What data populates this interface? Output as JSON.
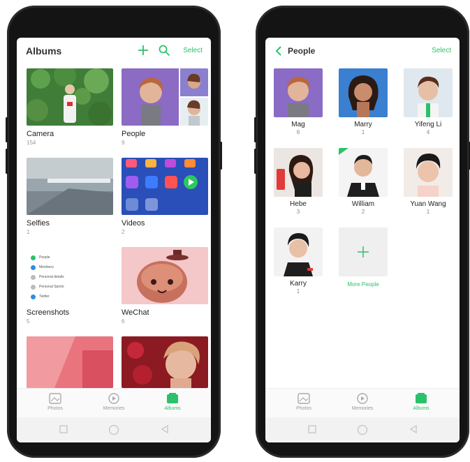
{
  "albums_screen": {
    "title": "Albums",
    "select_label": "Select",
    "icons": [
      "add-icon",
      "search-icon"
    ],
    "albums": [
      {
        "name": "Camera",
        "count": "154"
      },
      {
        "name": "People",
        "count": "9"
      },
      {
        "name": "Selfies",
        "count": "1"
      },
      {
        "name": "Videos",
        "count": "2"
      },
      {
        "name": "Screenshots",
        "count": "5"
      },
      {
        "name": "WeChat",
        "count": "6"
      }
    ],
    "screenshot_preview_lines": [
      "People",
      "Members",
      "Personal details",
      "Personal Sports",
      "Twitter"
    ]
  },
  "people_screen": {
    "title": "People",
    "select_label": "Select",
    "people": [
      {
        "name": "Mag",
        "count": "6"
      },
      {
        "name": "Marry",
        "count": "1"
      },
      {
        "name": "Yifeng Li",
        "count": "4"
      },
      {
        "name": "Hebe",
        "count": "3"
      },
      {
        "name": "William",
        "count": "2"
      },
      {
        "name": "Yuan Wang",
        "count": "1"
      },
      {
        "name": "Karry",
        "count": "1"
      }
    ],
    "more_people_label": "More People"
  },
  "tabs": [
    {
      "label": "Photos",
      "icon": "photos-icon"
    },
    {
      "label": "Memories",
      "icon": "memories-icon"
    },
    {
      "label": "Albums",
      "icon": "albums-icon",
      "active": true
    }
  ],
  "colors": {
    "accent": "#2bc16b",
    "phone_body": "#141414"
  }
}
